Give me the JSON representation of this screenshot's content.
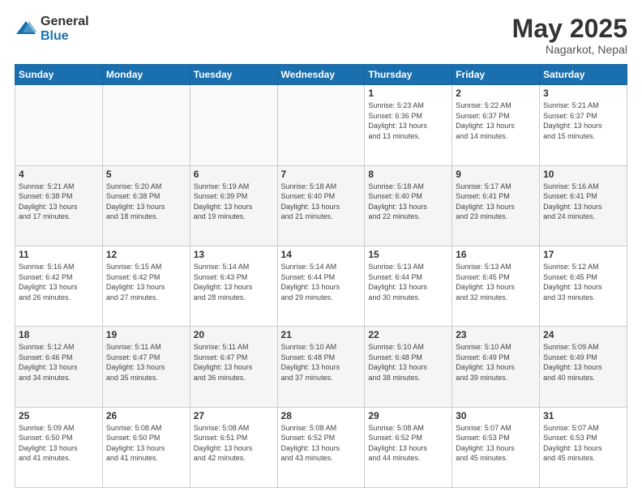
{
  "logo": {
    "general": "General",
    "blue": "Blue"
  },
  "title": "May 2025",
  "location": "Nagarkot, Nepal",
  "days": [
    "Sunday",
    "Monday",
    "Tuesday",
    "Wednesday",
    "Thursday",
    "Friday",
    "Saturday"
  ],
  "weeks": [
    [
      {
        "date": "",
        "info": ""
      },
      {
        "date": "",
        "info": ""
      },
      {
        "date": "",
        "info": ""
      },
      {
        "date": "",
        "info": ""
      },
      {
        "date": "1",
        "info": "Sunrise: 5:23 AM\nSunset: 6:36 PM\nDaylight: 13 hours\nand 13 minutes."
      },
      {
        "date": "2",
        "info": "Sunrise: 5:22 AM\nSunset: 6:37 PM\nDaylight: 13 hours\nand 14 minutes."
      },
      {
        "date": "3",
        "info": "Sunrise: 5:21 AM\nSunset: 6:37 PM\nDaylight: 13 hours\nand 15 minutes."
      }
    ],
    [
      {
        "date": "4",
        "info": "Sunrise: 5:21 AM\nSunset: 6:38 PM\nDaylight: 13 hours\nand 17 minutes."
      },
      {
        "date": "5",
        "info": "Sunrise: 5:20 AM\nSunset: 6:38 PM\nDaylight: 13 hours\nand 18 minutes."
      },
      {
        "date": "6",
        "info": "Sunrise: 5:19 AM\nSunset: 6:39 PM\nDaylight: 13 hours\nand 19 minutes."
      },
      {
        "date": "7",
        "info": "Sunrise: 5:18 AM\nSunset: 6:40 PM\nDaylight: 13 hours\nand 21 minutes."
      },
      {
        "date": "8",
        "info": "Sunrise: 5:18 AM\nSunset: 6:40 PM\nDaylight: 13 hours\nand 22 minutes."
      },
      {
        "date": "9",
        "info": "Sunrise: 5:17 AM\nSunset: 6:41 PM\nDaylight: 13 hours\nand 23 minutes."
      },
      {
        "date": "10",
        "info": "Sunrise: 5:16 AM\nSunset: 6:41 PM\nDaylight: 13 hours\nand 24 minutes."
      }
    ],
    [
      {
        "date": "11",
        "info": "Sunrise: 5:16 AM\nSunset: 6:42 PM\nDaylight: 13 hours\nand 26 minutes."
      },
      {
        "date": "12",
        "info": "Sunrise: 5:15 AM\nSunset: 6:42 PM\nDaylight: 13 hours\nand 27 minutes."
      },
      {
        "date": "13",
        "info": "Sunrise: 5:14 AM\nSunset: 6:43 PM\nDaylight: 13 hours\nand 28 minutes."
      },
      {
        "date": "14",
        "info": "Sunrise: 5:14 AM\nSunset: 6:44 PM\nDaylight: 13 hours\nand 29 minutes."
      },
      {
        "date": "15",
        "info": "Sunrise: 5:13 AM\nSunset: 6:44 PM\nDaylight: 13 hours\nand 30 minutes."
      },
      {
        "date": "16",
        "info": "Sunrise: 5:13 AM\nSunset: 6:45 PM\nDaylight: 13 hours\nand 32 minutes."
      },
      {
        "date": "17",
        "info": "Sunrise: 5:12 AM\nSunset: 6:45 PM\nDaylight: 13 hours\nand 33 minutes."
      }
    ],
    [
      {
        "date": "18",
        "info": "Sunrise: 5:12 AM\nSunset: 6:46 PM\nDaylight: 13 hours\nand 34 minutes."
      },
      {
        "date": "19",
        "info": "Sunrise: 5:11 AM\nSunset: 6:47 PM\nDaylight: 13 hours\nand 35 minutes."
      },
      {
        "date": "20",
        "info": "Sunrise: 5:11 AM\nSunset: 6:47 PM\nDaylight: 13 hours\nand 36 minutes."
      },
      {
        "date": "21",
        "info": "Sunrise: 5:10 AM\nSunset: 6:48 PM\nDaylight: 13 hours\nand 37 minutes."
      },
      {
        "date": "22",
        "info": "Sunrise: 5:10 AM\nSunset: 6:48 PM\nDaylight: 13 hours\nand 38 minutes."
      },
      {
        "date": "23",
        "info": "Sunrise: 5:10 AM\nSunset: 6:49 PM\nDaylight: 13 hours\nand 39 minutes."
      },
      {
        "date": "24",
        "info": "Sunrise: 5:09 AM\nSunset: 6:49 PM\nDaylight: 13 hours\nand 40 minutes."
      }
    ],
    [
      {
        "date": "25",
        "info": "Sunrise: 5:09 AM\nSunset: 6:50 PM\nDaylight: 13 hours\nand 41 minutes."
      },
      {
        "date": "26",
        "info": "Sunrise: 5:08 AM\nSunset: 6:50 PM\nDaylight: 13 hours\nand 41 minutes."
      },
      {
        "date": "27",
        "info": "Sunrise: 5:08 AM\nSunset: 6:51 PM\nDaylight: 13 hours\nand 42 minutes."
      },
      {
        "date": "28",
        "info": "Sunrise: 5:08 AM\nSunset: 6:52 PM\nDaylight: 13 hours\nand 43 minutes."
      },
      {
        "date": "29",
        "info": "Sunrise: 5:08 AM\nSunset: 6:52 PM\nDaylight: 13 hours\nand 44 minutes."
      },
      {
        "date": "30",
        "info": "Sunrise: 5:07 AM\nSunset: 6:53 PM\nDaylight: 13 hours\nand 45 minutes."
      },
      {
        "date": "31",
        "info": "Sunrise: 5:07 AM\nSunset: 6:53 PM\nDaylight: 13 hours\nand 45 minutes."
      }
    ]
  ]
}
